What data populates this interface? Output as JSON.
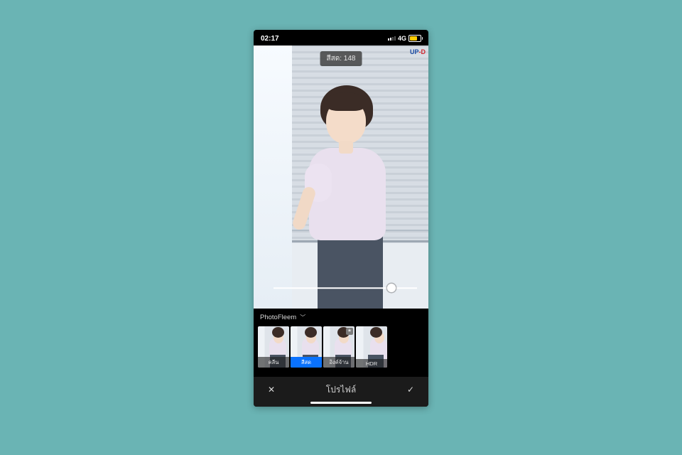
{
  "status": {
    "time": "02:17",
    "network": "4G"
  },
  "toast": {
    "label": "สีสด:",
    "value": "148"
  },
  "slider": {
    "position_pct": 82
  },
  "preset_group": {
    "name": "PhotoFleem"
  },
  "sign": {
    "prefix": "UP",
    "suffix": "-D"
  },
  "thumbnails": [
    {
      "label": "คลีน",
      "active": false,
      "starred": false
    },
    {
      "label": "สีสด",
      "active": true,
      "starred": false
    },
    {
      "label": "อิงค์จ้าน",
      "active": false,
      "starred": true
    },
    {
      "label": "HDR",
      "active": false,
      "starred": false
    }
  ],
  "bottom": {
    "title": "โปรไฟล์"
  }
}
